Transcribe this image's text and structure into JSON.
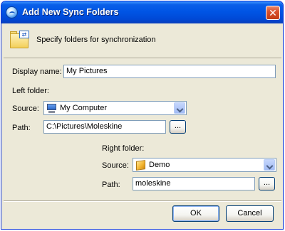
{
  "window": {
    "title": "Add New Sync Folders",
    "close_glyph": "✕"
  },
  "header": {
    "text": "Specify folders for synchronization",
    "icon": "sync-folder-icon"
  },
  "form": {
    "display_name_label": "Display name:",
    "display_name_value": "My Pictures",
    "left": {
      "heading": "Left folder:",
      "source_label": "Source:",
      "source_value": "My Computer",
      "source_icon": "computer-icon",
      "path_label": "Path:",
      "path_value": "C:\\Pictures\\Moleskine",
      "browse_label": "..."
    },
    "right": {
      "heading": "Right folder:",
      "source_label": "Source:",
      "source_value": "Demo",
      "source_icon": "box-icon",
      "path_label": "Path:",
      "path_value": "moleskine",
      "browse_label": "..."
    }
  },
  "buttons": {
    "ok": "OK",
    "cancel": "Cancel"
  },
  "colors": {
    "title_bar": "#0055e5",
    "dialog_bg": "#ece9d8",
    "field_border": "#7f9db9"
  }
}
